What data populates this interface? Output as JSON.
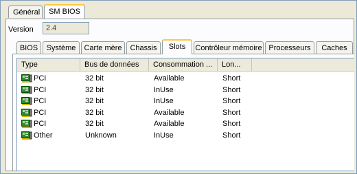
{
  "top_tabs": [
    {
      "label": "Général"
    },
    {
      "label": "SM BIOS"
    }
  ],
  "version": {
    "label": "Version",
    "value": "2.4"
  },
  "sub_tabs": [
    {
      "label": "BIOS"
    },
    {
      "label": "Système"
    },
    {
      "label": "Carte mère"
    },
    {
      "label": "Chassis"
    },
    {
      "label": "Slots"
    },
    {
      "label": "Contrôleur mémoire"
    },
    {
      "label": "Processeurs"
    },
    {
      "label": "Caches"
    }
  ],
  "list": {
    "columns": [
      "Type",
      "Bus de données",
      "Consommation ...",
      "Lon..."
    ],
    "rows": [
      {
        "type": "PCI",
        "bus": "32 bit",
        "usage": "Available",
        "length": "Short",
        "icon": "slot-card-icon"
      },
      {
        "type": "PCI",
        "bus": "32 bit",
        "usage": "InUse",
        "length": "Short",
        "icon": "slot-card-icon"
      },
      {
        "type": "PCI",
        "bus": "32 bit",
        "usage": "InUse",
        "length": "Short",
        "icon": "slot-card-icon"
      },
      {
        "type": "PCI",
        "bus": "32 bit",
        "usage": "Available",
        "length": "Short",
        "icon": "slot-card-icon"
      },
      {
        "type": "PCI",
        "bus": "32 bit",
        "usage": "Available",
        "length": "Short",
        "icon": "slot-card-icon"
      },
      {
        "type": "Other",
        "bus": "Unknown",
        "usage": "InUse",
        "length": "Short",
        "icon": "slot-card-icon"
      }
    ]
  }
}
